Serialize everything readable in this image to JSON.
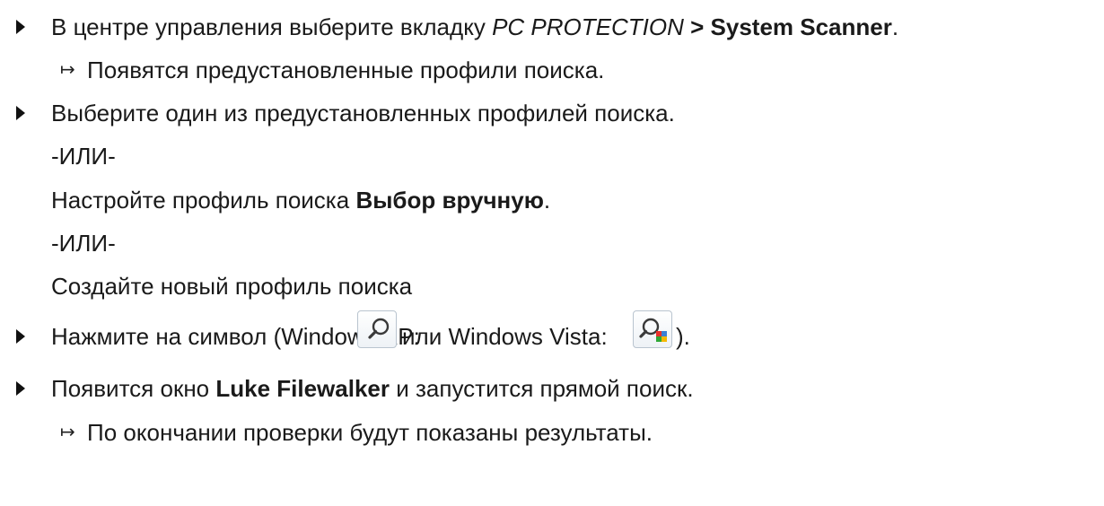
{
  "steps": [
    {
      "marker": "bullet",
      "prefix": "В центре управления выберите вкладку ",
      "italic": "PC PROTECTION",
      "separator": " > ",
      "bold": "System Scanner",
      "suffix": "."
    },
    {
      "marker": "arrow",
      "text": "Появятся предустановленные профили поиска."
    },
    {
      "marker": "bullet",
      "text": "Выберите один из предустановленных профилей поиска."
    },
    {
      "marker": "none",
      "text": "-ИЛИ-"
    },
    {
      "marker": "none",
      "prefix": "Настройте профиль поиска ",
      "bold": "Выбор вручную",
      "suffix": "."
    },
    {
      "marker": "none",
      "text": "-ИЛИ-"
    },
    {
      "marker": "none",
      "text": "Создайте новый профиль поиска"
    },
    {
      "marker": "bullet",
      "part1": "Нажмите на символ (Windows XP: ",
      "part2": " или Windows Vista: ",
      "part3": " )."
    },
    {
      "marker": "bullet",
      "prefix": "Появится окно ",
      "bold": "Luke Filewalker",
      "suffix": " и запустится прямой поиск."
    },
    {
      "marker": "arrow",
      "text": "По окончании проверки будут показаны результаты."
    }
  ],
  "icons": {
    "arrow_glyph": "↦",
    "xp_icon": "magnifier-icon",
    "vista_icon": "color-magnifier-icon",
    "vista_colors": [
      "#e8312b",
      "#3b7fd6",
      "#2fa836",
      "#f5b800"
    ]
  }
}
